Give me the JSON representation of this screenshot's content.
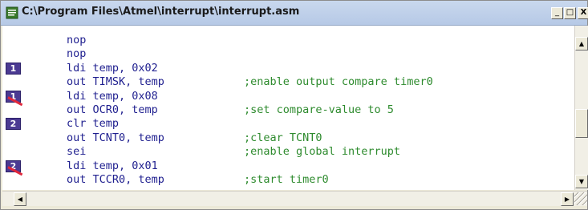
{
  "window": {
    "title": "C:\\Program Files\\Atmel\\interrupt\\interrupt.asm",
    "icon": "document-icon",
    "controls": {
      "minimize": "_",
      "maximize": "□",
      "close": "X"
    }
  },
  "editor": {
    "lines": [
      {
        "code": "nop",
        "comment": ""
      },
      {
        "code": "nop",
        "comment": ""
      },
      {
        "code": "ldi temp, 0x02",
        "comment": "",
        "marker": "1"
      },
      {
        "code": "out TIMSK, temp",
        "comment": ";enable output compare timer0"
      },
      {
        "code": "ldi temp, 0x08",
        "comment": "",
        "marker": "1",
        "marker_struck": true
      },
      {
        "code": "out OCR0, temp",
        "comment": ";set compare-value to 5"
      },
      {
        "code": "clr temp",
        "comment": "",
        "marker": "2"
      },
      {
        "code": "out TCNT0, temp",
        "comment": ";clear TCNT0"
      },
      {
        "code": "sei",
        "comment": ";enable global interrupt"
      },
      {
        "code": "ldi temp, 0x01",
        "comment": "",
        "marker": "2",
        "marker_struck": true
      },
      {
        "code": "out TCCR0, temp",
        "comment": ";start timer0"
      }
    ],
    "colors": {
      "code": "#1f1f8f",
      "comment": "#2e8b2e",
      "marker": "#4b3a92",
      "strike": "#e0283c"
    }
  },
  "scrollbars": {
    "up_arrow": "▲",
    "down_arrow": "▼",
    "left_arrow": "◀",
    "right_arrow": "▶"
  }
}
